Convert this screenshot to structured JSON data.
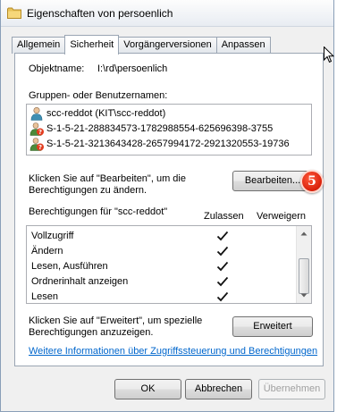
{
  "window": {
    "title": "Eigenschaften von persoenlich"
  },
  "tabs": [
    {
      "label": "Allgemein"
    },
    {
      "label": "Sicherheit"
    },
    {
      "label": "Vorgängerversionen"
    },
    {
      "label": "Anpassen"
    }
  ],
  "security": {
    "object_label": "Objektname:",
    "object_value": "I:\\rd\\persoenlich",
    "groups_label": "Gruppen- oder Benutzernamen:",
    "users": [
      {
        "name": "scc-reddot (KIT\\scc-reddot)",
        "icon": "user-icon"
      },
      {
        "name": "S-1-5-21-288834573-1782988554-625696398-3755",
        "icon": "unknown-user-icon"
      },
      {
        "name": "S-1-5-21-3213643428-2657994172-2921320553-19736",
        "icon": "unknown-user-icon"
      }
    ],
    "edit_hint_line1": "Klicken Sie auf \"Bearbeiten\", um die",
    "edit_hint_line2": "Berechtigungen zu ändern.",
    "edit_button": "Bearbeiten...",
    "badge": "5",
    "permissions_label": "Berechtigungen für \"scc-reddot\"",
    "col_allow": "Zulassen",
    "col_deny": "Verweigern",
    "permissions": [
      {
        "name": "Vollzugriff",
        "allow": true
      },
      {
        "name": "Ändern",
        "allow": true
      },
      {
        "name": "Lesen, Ausführen",
        "allow": true
      },
      {
        "name": "Ordnerinhalt anzeigen",
        "allow": true
      },
      {
        "name": "Lesen",
        "allow": true
      }
    ],
    "advanced_hint_line1": "Klicken Sie auf \"Erweitert\", um spezielle",
    "advanced_hint_line2": "Berechtigungen anzuzeigen.",
    "advanced_button": "Erweitert",
    "info_link": "Weitere Informationen über Zugriffssteuerung und Berechtigungen"
  },
  "footer": {
    "ok": "OK",
    "cancel": "Abbrechen",
    "apply": "Übernehmen"
  },
  "colors": {
    "badge": "#d9200a",
    "link": "#0066cc"
  }
}
